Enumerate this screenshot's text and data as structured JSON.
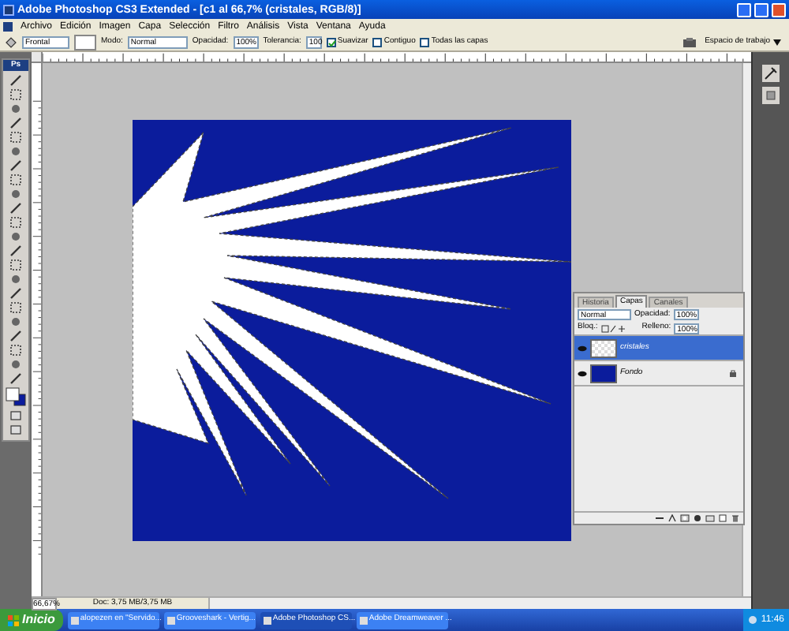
{
  "window": {
    "title": "Adobe Photoshop CS3 Extended - [c1 al 66,7% (cristales, RGB/8)]"
  },
  "menu": [
    "Archivo",
    "Edición",
    "Imagen",
    "Capa",
    "Selección",
    "Filtro",
    "Análisis",
    "Vista",
    "Ventana",
    "Ayuda"
  ],
  "options_bar": {
    "fill_source": "Frontal",
    "mode_label": "Modo:",
    "mode": "Normal",
    "opacity_label": "Opacidad:",
    "opacity": "100%",
    "tolerance_label": "Tolerancia:",
    "tolerance": "100",
    "checkboxes": [
      {
        "label": "Suavizar",
        "checked": true
      },
      {
        "label": "Contiguo",
        "checked": false
      },
      {
        "label": "Todas las capas",
        "checked": false
      }
    ],
    "workspace": "Espacio de trabajo"
  },
  "toolbox": {
    "logo": "Ps"
  },
  "layers_panel": {
    "tabs": [
      {
        "label": "Historia",
        "selected": false
      },
      {
        "label": "Capas",
        "selected": true
      },
      {
        "label": "Canales",
        "selected": false
      }
    ],
    "blend_mode": "Normal",
    "opacity_label": "Opacidad:",
    "opacity": "100%",
    "lock_label": "Bloq.:",
    "fill_label": "Relleno:",
    "fill": "100%",
    "layers": [
      {
        "name": "cristales",
        "selected": true,
        "visible": true,
        "locked": false,
        "kind": "transparent"
      },
      {
        "name": "Fondo",
        "selected": false,
        "visible": true,
        "locked": true,
        "kind": "solid"
      }
    ]
  },
  "document_status": {
    "zoom": "66,67%",
    "info": "Doc: 3,75 MB/3,75 MB"
  },
  "taskbar": {
    "start": "Inicio",
    "tasks": [
      {
        "label": "alopezen en \"Servido...",
        "selected": false
      },
      {
        "label": "Grooveshark - Vertig...",
        "selected": false
      },
      {
        "label": "Adobe Photoshop CS...",
        "selected": true
      },
      {
        "label": "Adobe Dreamweaver ...",
        "selected": false
      }
    ],
    "clock": "11:46"
  }
}
